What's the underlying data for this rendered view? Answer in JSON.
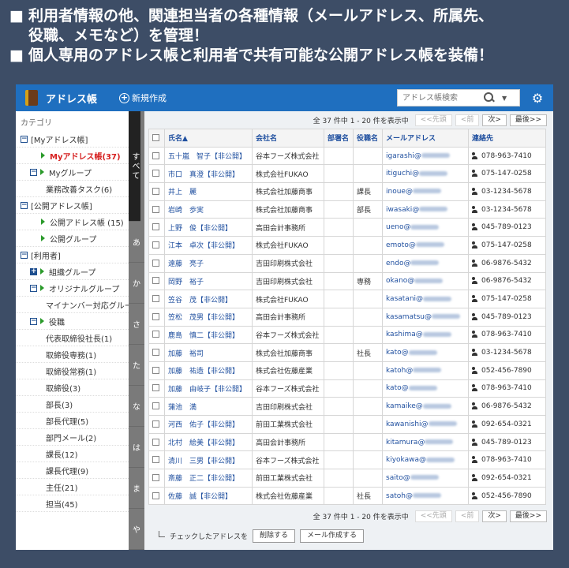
{
  "headline": {
    "bullet": "■",
    "line1": "利用者情報の他、関連担当者の各種情報（メールアドレス、所属先、",
    "line1b": "役職、メモなど）を管理！",
    "line2": "個人専用のアドレス帳と利用者で共有可能な公開アドレス帳を装備！"
  },
  "topbar": {
    "title": "アドレス帳",
    "new_label": "新規作成",
    "search_placeholder": "アドレス帳検索",
    "icons": {
      "app": "address-book-icon",
      "new": "plus-circle-icon",
      "search": "search-icon",
      "dropdown": "caret-down-icon",
      "settings": "gear-icon"
    }
  },
  "sidebar": {
    "category_label": "カテゴリ",
    "items": [
      {
        "label": "[Myアドレス帳]",
        "marker": "box-minus",
        "indent": 0
      },
      {
        "label": "Myアドレス帳(37)",
        "marker": "tri",
        "indent": 1,
        "active": true
      },
      {
        "label": "Myグループ",
        "marker": "box-minus-tri",
        "indent": 1
      },
      {
        "label": "業務改善タスク(6)",
        "marker": "none",
        "indent": 2
      },
      {
        "label": "[公開アドレス帳]",
        "marker": "box-minus",
        "indent": 0
      },
      {
        "label": "公開アドレス帳 (15)",
        "marker": "tri",
        "indent": 1
      },
      {
        "label": "公開グループ",
        "marker": "tri",
        "indent": 1
      },
      {
        "label": "[利用者]",
        "marker": "box-minus",
        "indent": 0
      },
      {
        "label": "組織グループ",
        "marker": "box-plus-tri",
        "indent": 1
      },
      {
        "label": "オリジナルグループ",
        "marker": "box-minus-tri",
        "indent": 1
      },
      {
        "label": "マイナンバー対応グループ",
        "marker": "none",
        "indent": 2
      },
      {
        "label": "役職",
        "marker": "box-minus-tri",
        "indent": 1
      },
      {
        "label": "代表取締役社長(1)",
        "marker": "none",
        "indent": 2
      },
      {
        "label": "取締役専務(1)",
        "marker": "none",
        "indent": 2
      },
      {
        "label": "取締役常務(1)",
        "marker": "none",
        "indent": 2
      },
      {
        "label": "取締役(3)",
        "marker": "none",
        "indent": 2
      },
      {
        "label": "部長(3)",
        "marker": "none",
        "indent": 2
      },
      {
        "label": "部長代理(5)",
        "marker": "none",
        "indent": 2
      },
      {
        "label": "部門メール(2)",
        "marker": "none",
        "indent": 2
      },
      {
        "label": "課長(12)",
        "marker": "none",
        "indent": 2
      },
      {
        "label": "課長代理(9)",
        "marker": "none",
        "indent": 2
      },
      {
        "label": "主任(21)",
        "marker": "none",
        "indent": 2
      },
      {
        "label": "担当(45)",
        "marker": "none",
        "indent": 2
      }
    ]
  },
  "kana_tabs": [
    "すべて",
    "あ",
    "か",
    "さ",
    "た",
    "な",
    "は",
    "ま",
    "や"
  ],
  "pager": {
    "info": "全 37 件中 1 - 20 件を表示中",
    "first": "<<先頭",
    "prev": "<前",
    "next": "次>",
    "last": "最後>>"
  },
  "table": {
    "headers": [
      "",
      "氏名▲",
      "会社名",
      "部署名",
      "役職名",
      "メールアドレス",
      "連絡先"
    ],
    "rows": [
      {
        "name": "五十嵐　智子【非公開】",
        "company": "谷本フーズ株式会社",
        "dept": "",
        "title": "",
        "email": "igarashi@",
        "tel": "078-963-7410"
      },
      {
        "name": "市口　真澄【非公開】",
        "company": "株式会社FUKAO",
        "dept": "",
        "title": "",
        "email": "itiguchi@",
        "tel": "075-147-0258"
      },
      {
        "name": "井上　麗",
        "company": "株式会社加藤商事",
        "dept": "",
        "title": "課長",
        "email": "inoue@",
        "tel": "03-1234-5678"
      },
      {
        "name": "岩崎　歩実",
        "company": "株式会社加藤商事",
        "dept": "",
        "title": "部長",
        "email": "iwasaki@",
        "tel": "03-1234-5678"
      },
      {
        "name": "上野　俊【非公開】",
        "company": "高田会計事務所",
        "dept": "",
        "title": "",
        "email": "ueno@",
        "tel": "045-789-0123"
      },
      {
        "name": "江本　卓次【非公開】",
        "company": "株式会社FUKAO",
        "dept": "",
        "title": "",
        "email": "emoto@",
        "tel": "075-147-0258"
      },
      {
        "name": "遠藤　亮子",
        "company": "吉田印刷株式会社",
        "dept": "",
        "title": "",
        "email": "endo@",
        "tel": "06-9876-5432"
      },
      {
        "name": "岡野　裕子",
        "company": "吉田印刷株式会社",
        "dept": "",
        "title": "専務",
        "email": "okano@",
        "tel": "06-9876-5432"
      },
      {
        "name": "笠谷　茂【非公開】",
        "company": "株式会社FUKAO",
        "dept": "",
        "title": "",
        "email": "kasatani@",
        "tel": "075-147-0258"
      },
      {
        "name": "笠松　茂男【非公開】",
        "company": "高田会計事務所",
        "dept": "",
        "title": "",
        "email": "kasamatsu@",
        "tel": "045-789-0123"
      },
      {
        "name": "鹿島　慎二【非公開】",
        "company": "谷本フーズ株式会社",
        "dept": "",
        "title": "",
        "email": "kashima@",
        "tel": "078-963-7410"
      },
      {
        "name": "加藤　裕司",
        "company": "株式会社加藤商事",
        "dept": "",
        "title": "社長",
        "email": "kato@",
        "tel": "03-1234-5678"
      },
      {
        "name": "加藤　祐造【非公開】",
        "company": "株式会社佐藤産業",
        "dept": "",
        "title": "",
        "email": "katoh@",
        "tel": "052-456-7890"
      },
      {
        "name": "加藤　由岐子【非公開】",
        "company": "谷本フーズ株式会社",
        "dept": "",
        "title": "",
        "email": "kato@",
        "tel": "078-963-7410"
      },
      {
        "name": "蒲池　満",
        "company": "吉田印刷株式会社",
        "dept": "",
        "title": "",
        "email": "kamaike@",
        "tel": "06-9876-5432"
      },
      {
        "name": "河西　佑子【非公開】",
        "company": "前田工業株式会社",
        "dept": "",
        "title": "",
        "email": "kawanishi@",
        "tel": "092-654-0321"
      },
      {
        "name": "北村　絵美【非公開】",
        "company": "高田会計事務所",
        "dept": "",
        "title": "",
        "email": "kitamura@",
        "tel": "045-789-0123"
      },
      {
        "name": "清川　三男【非公開】",
        "company": "谷本フーズ株式会社",
        "dept": "",
        "title": "",
        "email": "kiyokawa@",
        "tel": "078-963-7410"
      },
      {
        "name": "斎藤　正二【非公開】",
        "company": "前田工業株式会社",
        "dept": "",
        "title": "",
        "email": "saito@",
        "tel": "092-654-0321"
      },
      {
        "name": "佐藤　誠【非公開】",
        "company": "株式会社佐藤産業",
        "dept": "",
        "title": "社長",
        "email": "satoh@",
        "tel": "052-456-7890"
      }
    ]
  },
  "footer": {
    "checked_label": "チェックしたアドレスを",
    "delete_btn": "削除する",
    "mail_btn": "メール作成する"
  }
}
